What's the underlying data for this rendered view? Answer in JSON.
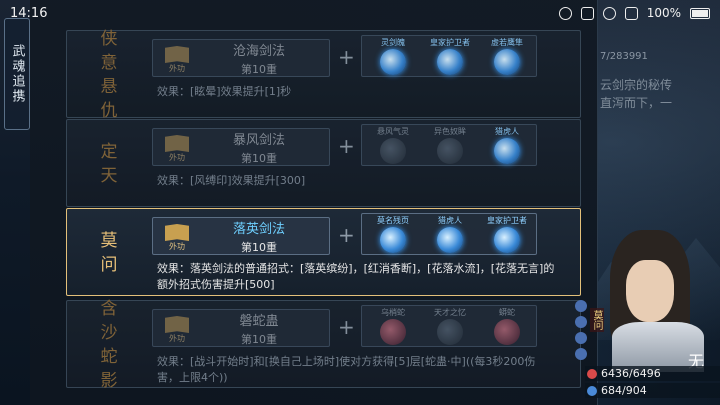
{
  "status_bar": {
    "time": "14:16",
    "battery": "100%"
  },
  "side_tab": {
    "label": "武魂追携"
  },
  "lore": {
    "counter": "7/283991",
    "lines": [
      "云剑宗的秘传",
      "直泻而下，一"
    ]
  },
  "rows": [
    {
      "title": [
        "侠",
        "意",
        "悬",
        "仇"
      ],
      "skill_tag": "外功",
      "skill_name": "沧海剑法",
      "skill_level": "第10重",
      "partners": [
        {
          "name": "灵剑魄",
          "active": true
        },
        {
          "name": "皇家护卫者",
          "active": true
        },
        {
          "name": "虚若鹰隼",
          "active": true
        }
      ],
      "effect": "效果：[眩晕]效果提升[1]秒",
      "state": "dim"
    },
    {
      "title": [
        "定",
        "天"
      ],
      "skill_tag": "外功",
      "skill_name": "暴风剑法",
      "skill_level": "第10重",
      "partners": [
        {
          "name": "悬风气灵",
          "active": false
        },
        {
          "name": "异色奴眸",
          "active": false
        },
        {
          "name": "猎虎人",
          "active": true
        }
      ],
      "effect": "效果：[风缚印]效果提升[300]",
      "state": "dim"
    },
    {
      "title": [
        "莫",
        "问"
      ],
      "skill_tag": "外功",
      "skill_name": "落英剑法",
      "skill_level": "第10重",
      "partners": [
        {
          "name": "莫名残页",
          "active": true
        },
        {
          "name": "猎虎人",
          "active": true
        },
        {
          "name": "皇家护卫者",
          "active": true
        }
      ],
      "effect": "效果：落英剑法的普通招式：[落英缤纷]，[红消香断]，[花落水流]，[花落无言]的额外招式伤害提升[500]",
      "state": "active"
    },
    {
      "title": [
        "含",
        "沙",
        "蛇",
        "影"
      ],
      "skill_tag": "外功",
      "skill_name": "磐蛇蛊",
      "skill_level": "第10重",
      "partners": [
        {
          "name": "乌梢蛇",
          "active": false,
          "tone": "red"
        },
        {
          "name": "天才之忆",
          "active": false
        },
        {
          "name": "蟒蛇",
          "active": false,
          "tone": "red"
        }
      ],
      "effect": "效果：[战斗开始时]和[换自己上场时]使对方获得[5]层[蛇蛊·中]((每3秒200伤害，上限4个))",
      "state": "dim"
    }
  ],
  "character": {
    "name_vertical": "莫问",
    "name_char": "无",
    "hp": "6436/6496",
    "mp": "684/904"
  },
  "colors": {
    "accent_gold": "#e3c07a",
    "skill_blue": "#6fd0ff"
  }
}
